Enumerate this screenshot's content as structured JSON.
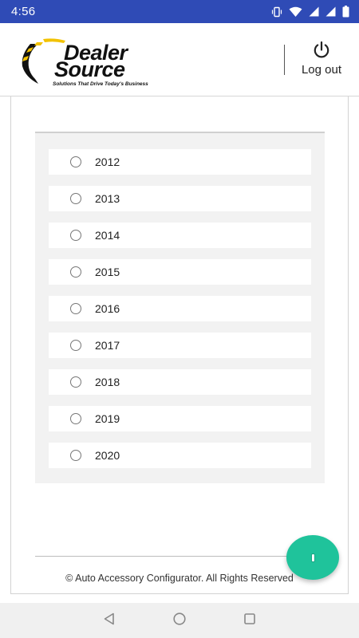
{
  "status_bar": {
    "time": "4:56",
    "icons": [
      "vibrate-icon",
      "wifi-icon",
      "signal-icon",
      "signal-icon",
      "battery-icon"
    ]
  },
  "header": {
    "logo": {
      "line1": "Dealer",
      "line2": "Source",
      "tagline": "Solutions That Drive Today's Business"
    },
    "logout": {
      "label": "Log out",
      "icon": "power-icon"
    }
  },
  "years": {
    "options": [
      "2012",
      "2013",
      "2014",
      "2015",
      "2016",
      "2017",
      "2018",
      "2019",
      "2020"
    ],
    "selected": null
  },
  "footer": {
    "text": "© Auto Accessory Configurator. All Rights Reserved"
  },
  "fab": {
    "color": "#1fc39b"
  },
  "nav": {
    "buttons": [
      "back-icon",
      "home-icon",
      "recents-icon"
    ]
  },
  "colors": {
    "status_bar": "#2f4bb6",
    "panel_bg": "#f2f2f2",
    "accent": "#1fc39b"
  }
}
